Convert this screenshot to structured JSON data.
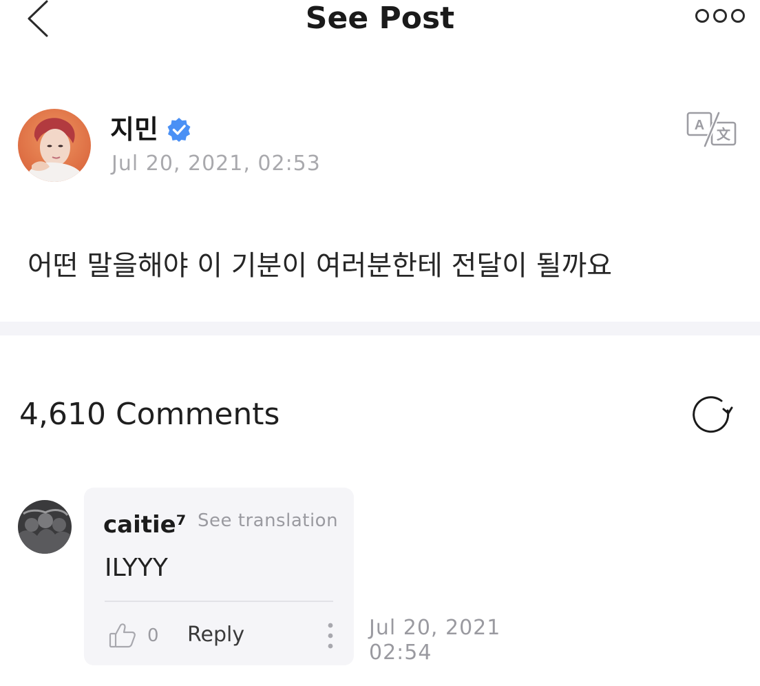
{
  "header": {
    "title": "See Post",
    "back_icon": "chevron-left-icon",
    "more_icon": "more-circles-icon"
  },
  "post": {
    "author": "지민",
    "verified_icon": "verified-badge-icon",
    "timestamp": "Jul 20, 2021, 02:53",
    "translate_icon": "translate-icon",
    "text": "어떤 말을해야 이 기분이 여러분한테 전달이 될까요"
  },
  "comments": {
    "count_label": "4,610 Comments",
    "refresh_icon": "refresh-icon",
    "items": [
      {
        "author": "caitie⁷",
        "see_translation": "See translation",
        "text": "ILYYY",
        "like_icon": "thumbs-up-icon",
        "likes": "0",
        "reply_label": "Reply",
        "more_icon": "vertical-dots-icon",
        "date": "Jul 20, 2021",
        "time": "02:54"
      }
    ]
  },
  "colors": {
    "accent_verified": "#4a90f5",
    "text_primary": "#1f1f1f",
    "text_secondary": "#a9a9ad",
    "bubble_bg": "#f5f5f8",
    "divider_bg": "#f4f4f8"
  }
}
